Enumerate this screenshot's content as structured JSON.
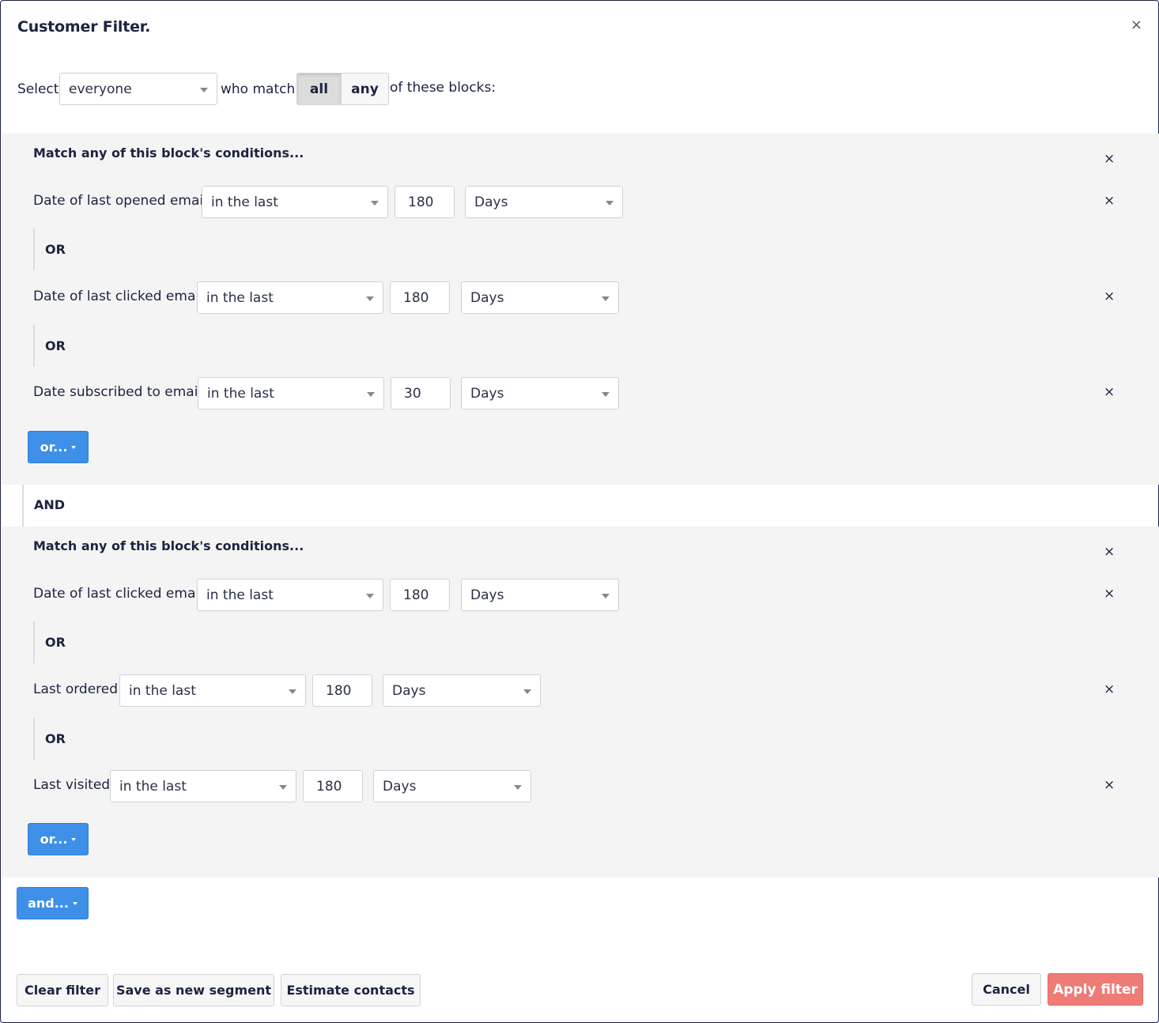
{
  "modal": {
    "title": "Customer Filter.",
    "close_icon": "×"
  },
  "selector": {
    "prefix": "Select",
    "audience": "everyone",
    "middle": "who match",
    "match_all": "all",
    "match_any": "any",
    "suffix": "of these blocks:"
  },
  "blocks": [
    {
      "title": "Match any of this block's conditions...",
      "remove_icon": "×",
      "conditions": [
        {
          "label": "Date of last opened email",
          "operator": "in the last",
          "value": "180",
          "unit": "Days"
        },
        {
          "label": "Date of last clicked email",
          "operator": "in the last",
          "value": "180",
          "unit": "Days"
        },
        {
          "label": "Date subscribed to email",
          "operator": "in the last",
          "value": "30",
          "unit": "Days"
        }
      ],
      "or_label": "OR",
      "or_button": "or..."
    },
    {
      "title": "Match any of this block's conditions...",
      "remove_icon": "×",
      "conditions": [
        {
          "label": "Date of last clicked email",
          "operator": "in the last",
          "value": "180",
          "unit": "Days"
        },
        {
          "label": "Last ordered",
          "operator": "in the last",
          "value": "180",
          "unit": "Days"
        },
        {
          "label": "Last visited",
          "operator": "in the last",
          "value": "180",
          "unit": "Days"
        }
      ],
      "or_label": "OR",
      "or_button": "or..."
    }
  ],
  "and_label": "AND",
  "and_button": "and...",
  "footer": {
    "clear": "Clear filter",
    "save_segment": "Save as new segment",
    "estimate": "Estimate contacts",
    "cancel": "Cancel",
    "apply": "Apply filter"
  },
  "colors": {
    "primary": "#3e8fe8",
    "apply": "#ee7b76",
    "block_bg": "#f4f4f4",
    "text": "#1c2340"
  },
  "icons": {
    "close": "close-icon",
    "remove": "remove-condition-icon",
    "caret": "chevron-down-icon"
  }
}
